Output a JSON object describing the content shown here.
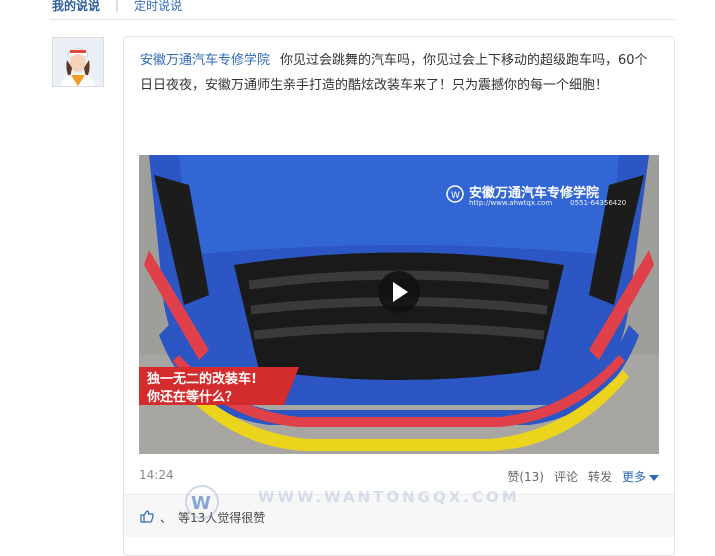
{
  "tabs": {
    "my_posts": "我的说说",
    "scheduled": "定时说说",
    "separator": "|"
  },
  "post": {
    "author": "安徽万通汽车专修学院",
    "text": "你见过会跳舞的汽车吗，你见过会上下移动的超级跑车吗，60个日日夜夜，安徽万通师生亲手打造的酷炫改装车来了！只为震撼你的每一个细胞！",
    "time": "14:24",
    "actions": {
      "like": "赞(13)",
      "comment": "评论",
      "share": "转发",
      "more": "更多"
    },
    "likes_summary": "等13人觉得很赞",
    "likes_sep": "、"
  },
  "video": {
    "brand": "安徽万通汽车专修学院",
    "site": "http://www.ahwtqx.com",
    "phone": "0551-64356420",
    "banner_line1": "独一无二的改装车!",
    "banner_line2": "你还在等什么？"
  },
  "colors": {
    "link": "#2e6ab8",
    "car_blue": "#2c56c4",
    "stripe_red": "#e0404a",
    "stripe_yellow": "#ecd41c"
  },
  "watermark": {
    "glyph": "W",
    "text": "WWW.WANTONGQX.COM"
  }
}
